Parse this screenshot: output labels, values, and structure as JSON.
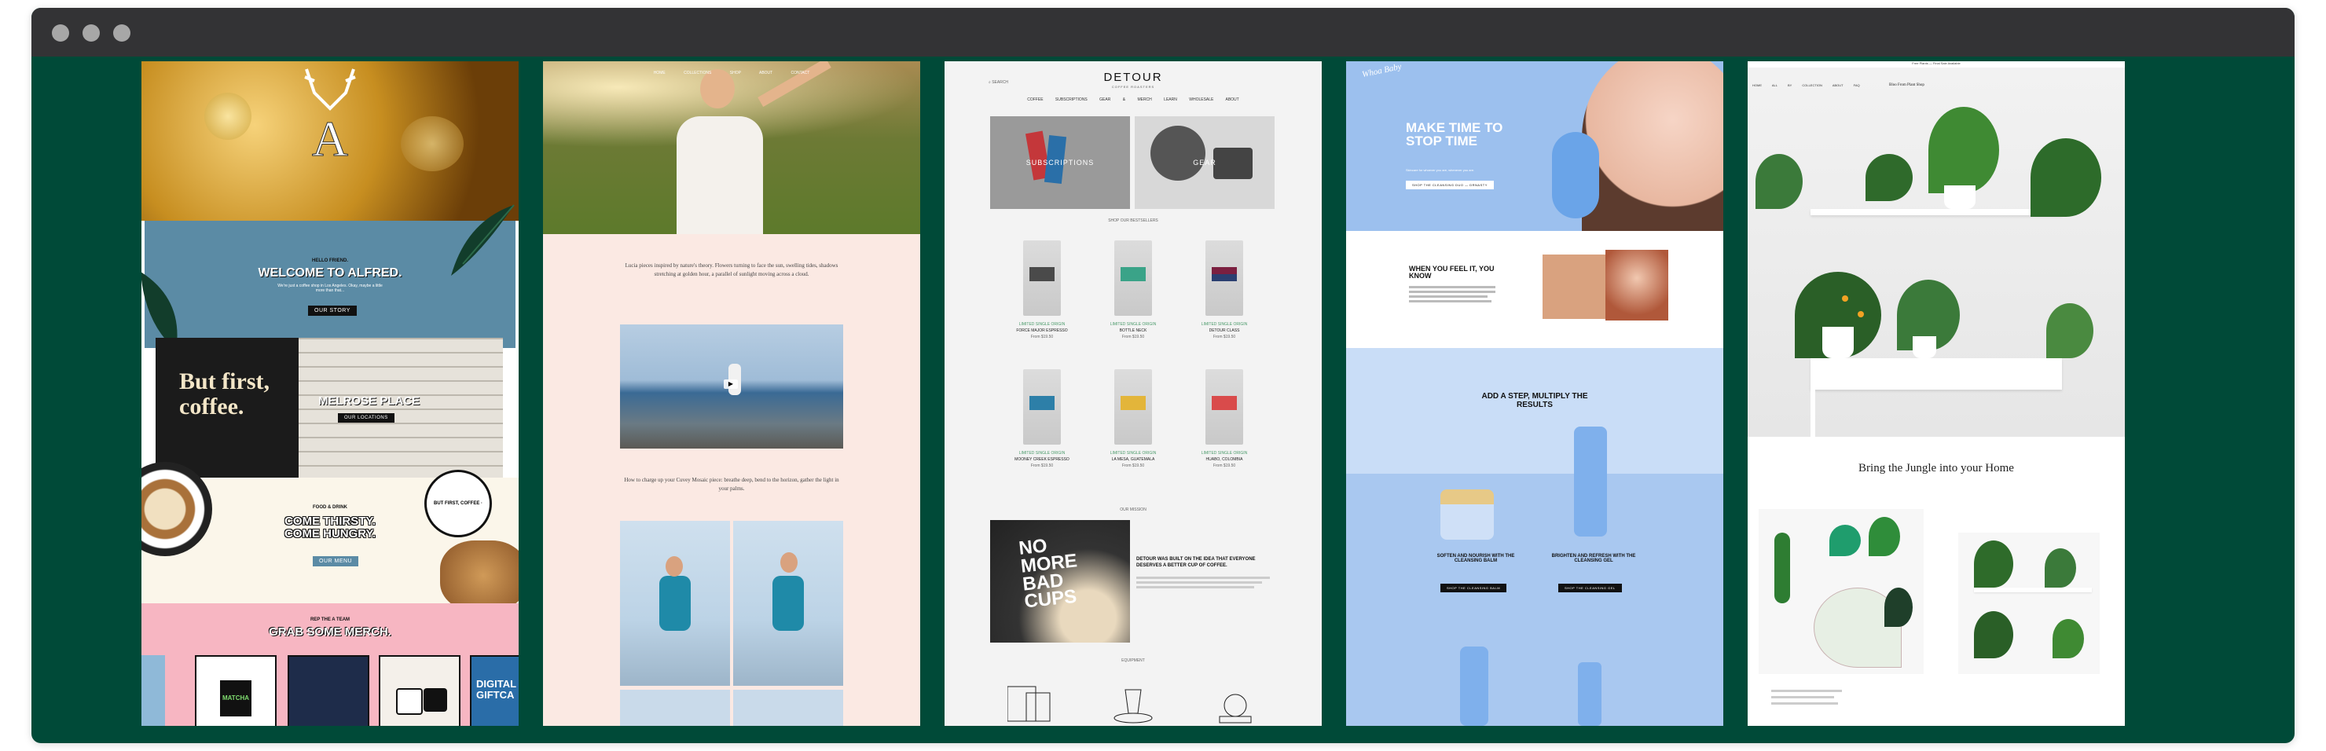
{
  "colors": {
    "window_bg": "#004a38",
    "titlebar": "#333335",
    "dot": "#a7a7a7",
    "alfred_blue": "#5b8ba5",
    "alfred_pink": "#f7b6c2",
    "cuppy_pink": "#fbe9e3",
    "whoa_blue": "#9cc0ee",
    "detour_bg": "#f3f3f3"
  },
  "window": {
    "controls": [
      "close",
      "minimize",
      "zoom"
    ]
  },
  "panel1": {
    "hello": "HELLO FRIEND.",
    "welcome": "WELCOME TO ALFRED.",
    "intro": "We're just a coffee shop in Los Angeles. Okay, maybe a little more than that...",
    "story_btn": "OUR STORY",
    "sign": "But first, coffee.",
    "melrose": "MELROSE PLACE",
    "locations_btn": "OUR LOCATIONS",
    "food_kicker": "FOOD & DRINK",
    "come": "COME THIRSTY. COME HUNGRY.",
    "menu_btn": "OUR MENU",
    "badge": "BUT FIRST, COFFEE · ALFRED ·",
    "merch_kicker": "REP THE A TEAM",
    "merch": "GRAB SOME MERCH.",
    "gift": "DIGITAL GIFTCA",
    "matcha": "MATCHA"
  },
  "panel2": {
    "nav": [
      "HOME",
      "COLLECTIONS",
      "SHOP",
      "ABOUT",
      "CONTACT"
    ],
    "para1": "Lucia pieces inspired by nature's theory. Flowers turning to face the sun, swelling tides, shadows stretching at golden hour, a parallel of sunlight moving across a cloud.",
    "para2": "How to charge up your Cuvey Mosaic piece: breathe deep, bend to the horizon, gather the light in your palms."
  },
  "panel3": {
    "logo": "DETOUR",
    "tagline": "COFFEE ROASTERS",
    "search": "SEARCH",
    "menu": [
      "COFFEE",
      "SUBSCRIPTIONS",
      "GEAR & MERCH",
      "LEARN",
      "WHOLESALE",
      "ABOUT"
    ],
    "tile1": "SUBSCRIPTIONS",
    "tile2": "GEAR",
    "best": "SHOP OUR BESTSELLERS",
    "products": [
      {
        "tag": "LIMITED SINGLE ORIGIN",
        "name": "FORCE MAJOR ESPRESSO",
        "price": "From $19.50"
      },
      {
        "tag": "LIMITED SINGLE ORIGIN",
        "name": "BOTTLE NECK",
        "price": "From $19.50"
      },
      {
        "tag": "LIMITED SINGLE ORIGIN",
        "name": "DETOUR CLASS",
        "price": "From $19.50"
      },
      {
        "tag": "LIMITED SINGLE ORIGIN",
        "name": "MOONEY CREEK ESPRESSO",
        "price": "From $19.50"
      },
      {
        "tag": "LIMITED SINGLE ORIGIN",
        "name": "LA MESA, GUATEMALA",
        "price": "From $19.50"
      },
      {
        "tag": "LIMITED SINGLE ORIGIN",
        "name": "HUABO, COLOMBIA",
        "price": "From $19.50"
      }
    ],
    "mission_kicker": "OUR MISSION",
    "nomore": "NO MORE BAD CUPS",
    "mission": "DETOUR WAS BUILT ON THE IDEA THAT EVERYONE DESERVES A BETTER CUP OF COFFEE.",
    "equip": "EQUIPMENT"
  },
  "panel4": {
    "logo": "Whoa Baby",
    "hero": "MAKE TIME TO STOP TIME",
    "hero_sub": "Skincare for whoever you are, whenever you are.",
    "hero_btn": "SHOP THE CLEANSING DUO — DRNASTY",
    "feel": "WHEN YOU FEEL IT, YOU KNOW",
    "add": "ADD A STEP, MULTIPLY THE RESULTS",
    "balm": "SOFTEN AND NOURISH WITH THE CLEANSING BALM",
    "gel": "BRIGHTEN AND REFRESH WITH THE CLEANSING GEL",
    "balm_btn": "SHOP THE CLEANSING BALM",
    "gel_btn": "SHOP THE CLEANSING GEL"
  },
  "panel5": {
    "announce": "Free Plants — Final Sale Available",
    "title": "Bring the Jungle into your Home",
    "nav": [
      "HOME",
      "ALL",
      "BY COLLECTION",
      "ABOUT",
      "FAQ"
    ],
    "brand": "Bloo From Plant Shop"
  }
}
